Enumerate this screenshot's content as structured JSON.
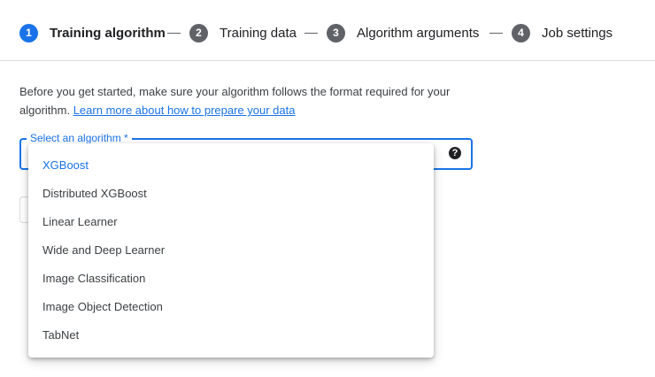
{
  "stepper": {
    "steps": [
      {
        "number": "1",
        "label": "Training algorithm",
        "active": true
      },
      {
        "number": "2",
        "label": "Training data",
        "active": false
      },
      {
        "number": "3",
        "label": "Algorithm arguments",
        "active": false
      },
      {
        "number": "4",
        "label": "Job settings",
        "active": false
      }
    ]
  },
  "intro": {
    "text": "Before you get started, make sure your algorithm follows the format required for your algorithm.",
    "link": "Learn more about how to prepare your data"
  },
  "algorithm_select": {
    "label": "Select an algorithm *",
    "help_icon": "question-circle-icon",
    "options": [
      "XGBoost",
      "Distributed XGBoost",
      "Linear Learner",
      "Wide and Deep Learner",
      "Image Classification",
      "Image Object Detection",
      "TabNet"
    ],
    "highlighted": "XGBoost"
  },
  "colors": {
    "accent": "#1a73e8",
    "step_inactive": "#5f6368",
    "divider": "#dadce0"
  }
}
